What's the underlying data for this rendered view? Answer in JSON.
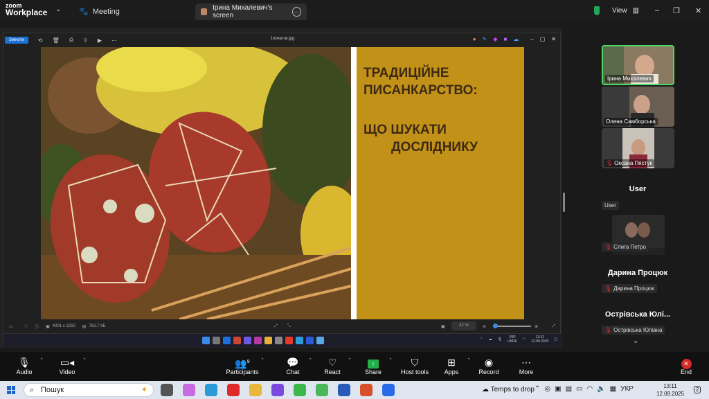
{
  "zoom": {
    "logo_line1": "zoom",
    "logo_line2": "Workplace",
    "meeting_label": "Meeting",
    "tab_title": "Ірина Михалевич's screen",
    "view_label": "View",
    "window_controls": [
      "–",
      "❐",
      "✕"
    ]
  },
  "viewer": {
    "edit_label": "Змінити",
    "file_name": "1початок.jpg",
    "dimensions": "4001 x 2250",
    "file_size": "762.7 КБ",
    "zoom_level": "42 %"
  },
  "slide": {
    "title_line1": "ТРАДИЦІЙНЕ",
    "title_line2": "ПИСАНКАРСТВО:",
    "sub_line1": "ЩО ШУКАТИ",
    "sub_line2": "ДОСЛІДНИКУ"
  },
  "remote_taskbar": {
    "lang": "УКР",
    "lang2": "UKRE",
    "time": "13:11",
    "date": "12.09.2025"
  },
  "participants": [
    {
      "name": "Ірина Михалевич",
      "muted": false
    },
    {
      "name": "Олена Самборська",
      "muted": false
    },
    {
      "name": "Оксана Пястук",
      "muted": true
    }
  ],
  "others": [
    {
      "heading": "User",
      "label": "User"
    },
    {
      "heading": "",
      "label": "Слига Петро"
    },
    {
      "heading": "Дарина Процюк",
      "label": "Дарина Процюк"
    },
    {
      "heading": "Острівська Юлі...",
      "label": "Острівська Юліана"
    }
  ],
  "toolbar": {
    "audio": "Audio",
    "video": "Video",
    "participants": "Participants",
    "participants_count": "9",
    "chat": "Chat",
    "react": "React",
    "share": "Share",
    "host_tools": "Host tools",
    "apps": "Apps",
    "record": "Record",
    "more": "More",
    "end": "End"
  },
  "windows": {
    "search_placeholder": "Пошук",
    "temps": "Temps to drop",
    "lang": "УКР",
    "time": "13:11",
    "date": "12.09.2025",
    "notif": "2"
  }
}
